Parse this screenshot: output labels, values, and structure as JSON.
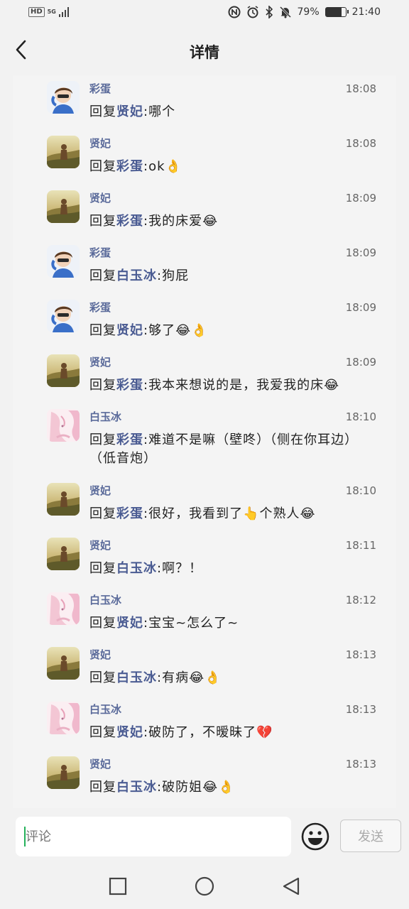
{
  "status_bar": {
    "hd": "HD",
    "network": "5G",
    "battery": "79%",
    "battery_level": 0.79,
    "time": "21:40",
    "icons": [
      "signal-icon",
      "nfc-icon",
      "alarm-icon",
      "bluetooth-icon",
      "mute-icon",
      "battery-icon"
    ]
  },
  "header": {
    "title": "详情",
    "back_icon": "back-arrow-icon"
  },
  "reply_prefix": "回复",
  "replies": [
    {
      "user": "彩蛋",
      "avatar": "boy",
      "time": "18:08",
      "target": "贤妃",
      "text": ":哪个",
      "emojis": ""
    },
    {
      "user": "贤妃",
      "avatar": "landscape",
      "time": "18:08",
      "target": "彩蛋",
      "text": ":ok",
      "emojis": "👌"
    },
    {
      "user": "贤妃",
      "avatar": "landscape",
      "time": "18:09",
      "target": "彩蛋",
      "text": ":我的床爱",
      "emojis": "😂"
    },
    {
      "user": "彩蛋",
      "avatar": "boy",
      "time": "18:09",
      "target": "白玉冰",
      "text": ":狗屁",
      "emojis": ""
    },
    {
      "user": "彩蛋",
      "avatar": "boy",
      "time": "18:09",
      "target": "贤妃",
      "text": ":够了",
      "emojis": "😂👌"
    },
    {
      "user": "贤妃",
      "avatar": "landscape",
      "time": "18:09",
      "target": "彩蛋",
      "text": ":我本来想说的是，我爱我的床",
      "emojis": "😂"
    },
    {
      "user": "白玉冰",
      "avatar": "anime",
      "time": "18:10",
      "target": "彩蛋",
      "text": ":难道不是嘛（壁咚）（侧在你耳边）（低音炮）",
      "emojis": ""
    },
    {
      "user": "贤妃",
      "avatar": "landscape",
      "time": "18:10",
      "target": "彩蛋",
      "text": ":很好，我看到了",
      "emojis": "👆",
      "text2": "个熟人",
      "emojis2": "😂"
    },
    {
      "user": "贤妃",
      "avatar": "landscape",
      "time": "18:11",
      "target": "白玉冰",
      "text": ":啊？！",
      "emojis": ""
    },
    {
      "user": "白玉冰",
      "avatar": "anime",
      "time": "18:12",
      "target": "贤妃",
      "text": ":宝宝~怎么了~",
      "emojis": ""
    },
    {
      "user": "贤妃",
      "avatar": "landscape",
      "time": "18:13",
      "target": "白玉冰",
      "text": ":有病",
      "emojis": "😂👌"
    },
    {
      "user": "白玉冰",
      "avatar": "anime",
      "time": "18:13",
      "target": "贤妃",
      "text": ":破防了，不暧昧了",
      "emojis": "💔"
    },
    {
      "user": "贤妃",
      "avatar": "landscape",
      "time": "18:13",
      "target": "白玉冰",
      "text": ":破防姐",
      "emojis": "😂👌"
    }
  ],
  "composer": {
    "placeholder": "评论",
    "emoji_icon": "smiley-icon",
    "send_label": "发送"
  },
  "system_nav": [
    "recents-square-icon",
    "home-circle-icon",
    "back-triangle-icon"
  ]
}
